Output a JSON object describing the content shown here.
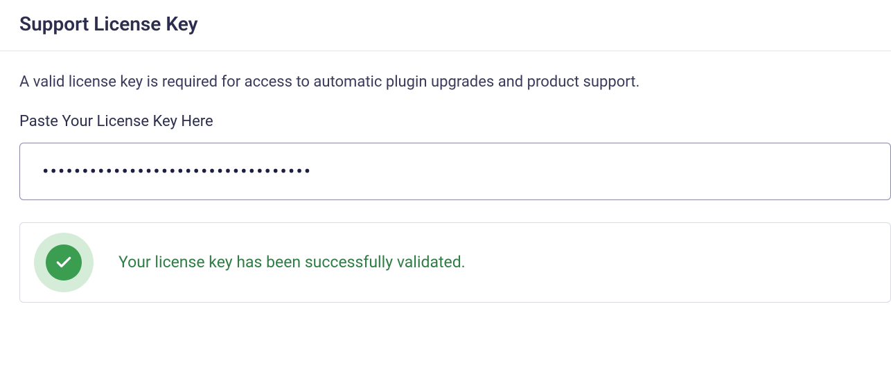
{
  "header": {
    "title": "Support License Key"
  },
  "license": {
    "description": "A valid license key is required for access to automatic plugin upgrades and product support.",
    "field_label": "Paste Your License Key Here",
    "input_value": "••••••••••••••••••••••••••••••••••"
  },
  "status": {
    "message": "Your license key has been successfully validated.",
    "icon": "check-icon"
  }
}
